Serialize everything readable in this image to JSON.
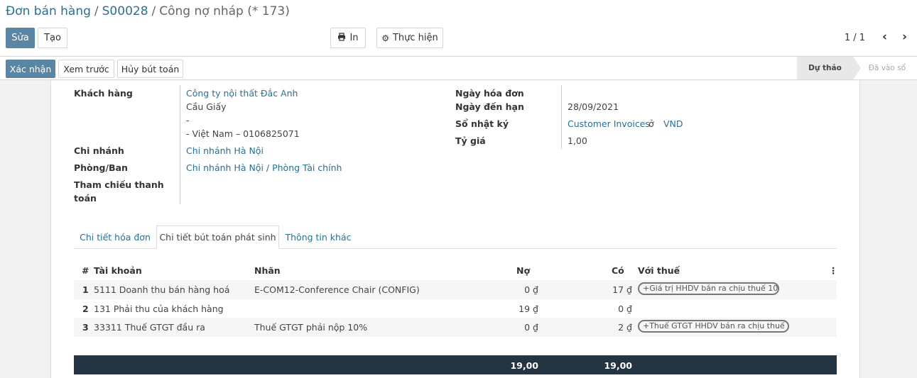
{
  "breadcrumb": {
    "part1": "Đơn bán hàng",
    "part2": "S00028",
    "current": "Công nợ nháp (* 173)",
    "separator": "/"
  },
  "toolbar": {
    "edit": "Sửa",
    "create": "Tạo",
    "print": "In",
    "action": "Thực hiện",
    "pager": "1 / 1"
  },
  "statusbar": {
    "confirm": "Xác nhận",
    "preview": "Xem trước",
    "cancel": "Hủy bút toán",
    "stages": [
      "Dự thảo",
      "Đã vào sổ"
    ]
  },
  "form": {
    "customer_label": "Khách hàng",
    "customer_name": "Công ty nội thất Đắc Anh",
    "address_line1": "Cầu Giấy",
    "address_line2": "-",
    "address_line3": "- Việt Nam – 0106825071",
    "branch_label": "Chi nhánh",
    "branch": "Chi nhánh Hà Nội",
    "department_label": "Phòng/Ban",
    "department": "Chi nhánh Hà Nội / Phòng Tài chính",
    "payment_ref_label_1": "Tham chiếu thanh",
    "payment_ref_label_2": "toán",
    "invoice_date_label": "Ngày hóa đơn",
    "due_date_label": "Ngày đến hạn",
    "due_date": "28/09/2021",
    "journal_label": "Sổ nhật ký",
    "journal": "Customer Invoices",
    "journal_in": "ở",
    "currency": "VND",
    "rate_label": "Tỷ giá",
    "rate": "1,00"
  },
  "tabs": [
    "Chi tiết hóa đơn",
    "Chi tiết bút toán phát sinh",
    "Thông tin khác"
  ],
  "table": {
    "headers": {
      "num": "#",
      "account": "Tài khoản",
      "label": "Nhãn",
      "debit": "Nợ",
      "credit": "Có",
      "tax": "Với thuế"
    },
    "rows": [
      {
        "num": "1",
        "account": "5111 Doanh thu bán hàng hoá",
        "label": "E-COM12-Conference Chair (CONFIG)",
        "debit": "0 ₫",
        "credit": "17 ₫",
        "tax": "+Giá trị HHDV bán ra chịu thuế 10%"
      },
      {
        "num": "2",
        "account": "131 Phải thu của khách hàng",
        "label": "",
        "debit": "19 ₫",
        "credit": "0 ₫",
        "tax": ""
      },
      {
        "num": "3",
        "account": "33311 Thuế GTGT đầu ra",
        "label": "Thuế GTGT phải nộp 10%",
        "debit": "0 ₫",
        "credit": "2 ₫",
        "tax": "+Thuế GTGT HHDV bán ra chịu thuế ..."
      }
    ],
    "totals": {
      "debit": "19,00",
      "credit": "19,00"
    }
  },
  "icons": {
    "print": "printer-icon",
    "action": "gear-icon",
    "prev": "chevron-left-icon",
    "next": "chevron-right-icon",
    "columns": "kebab-vertical-icon"
  },
  "colors": {
    "primary": "#5b86a3",
    "link": "#2c6f8f",
    "totals_bg": "#243442"
  }
}
